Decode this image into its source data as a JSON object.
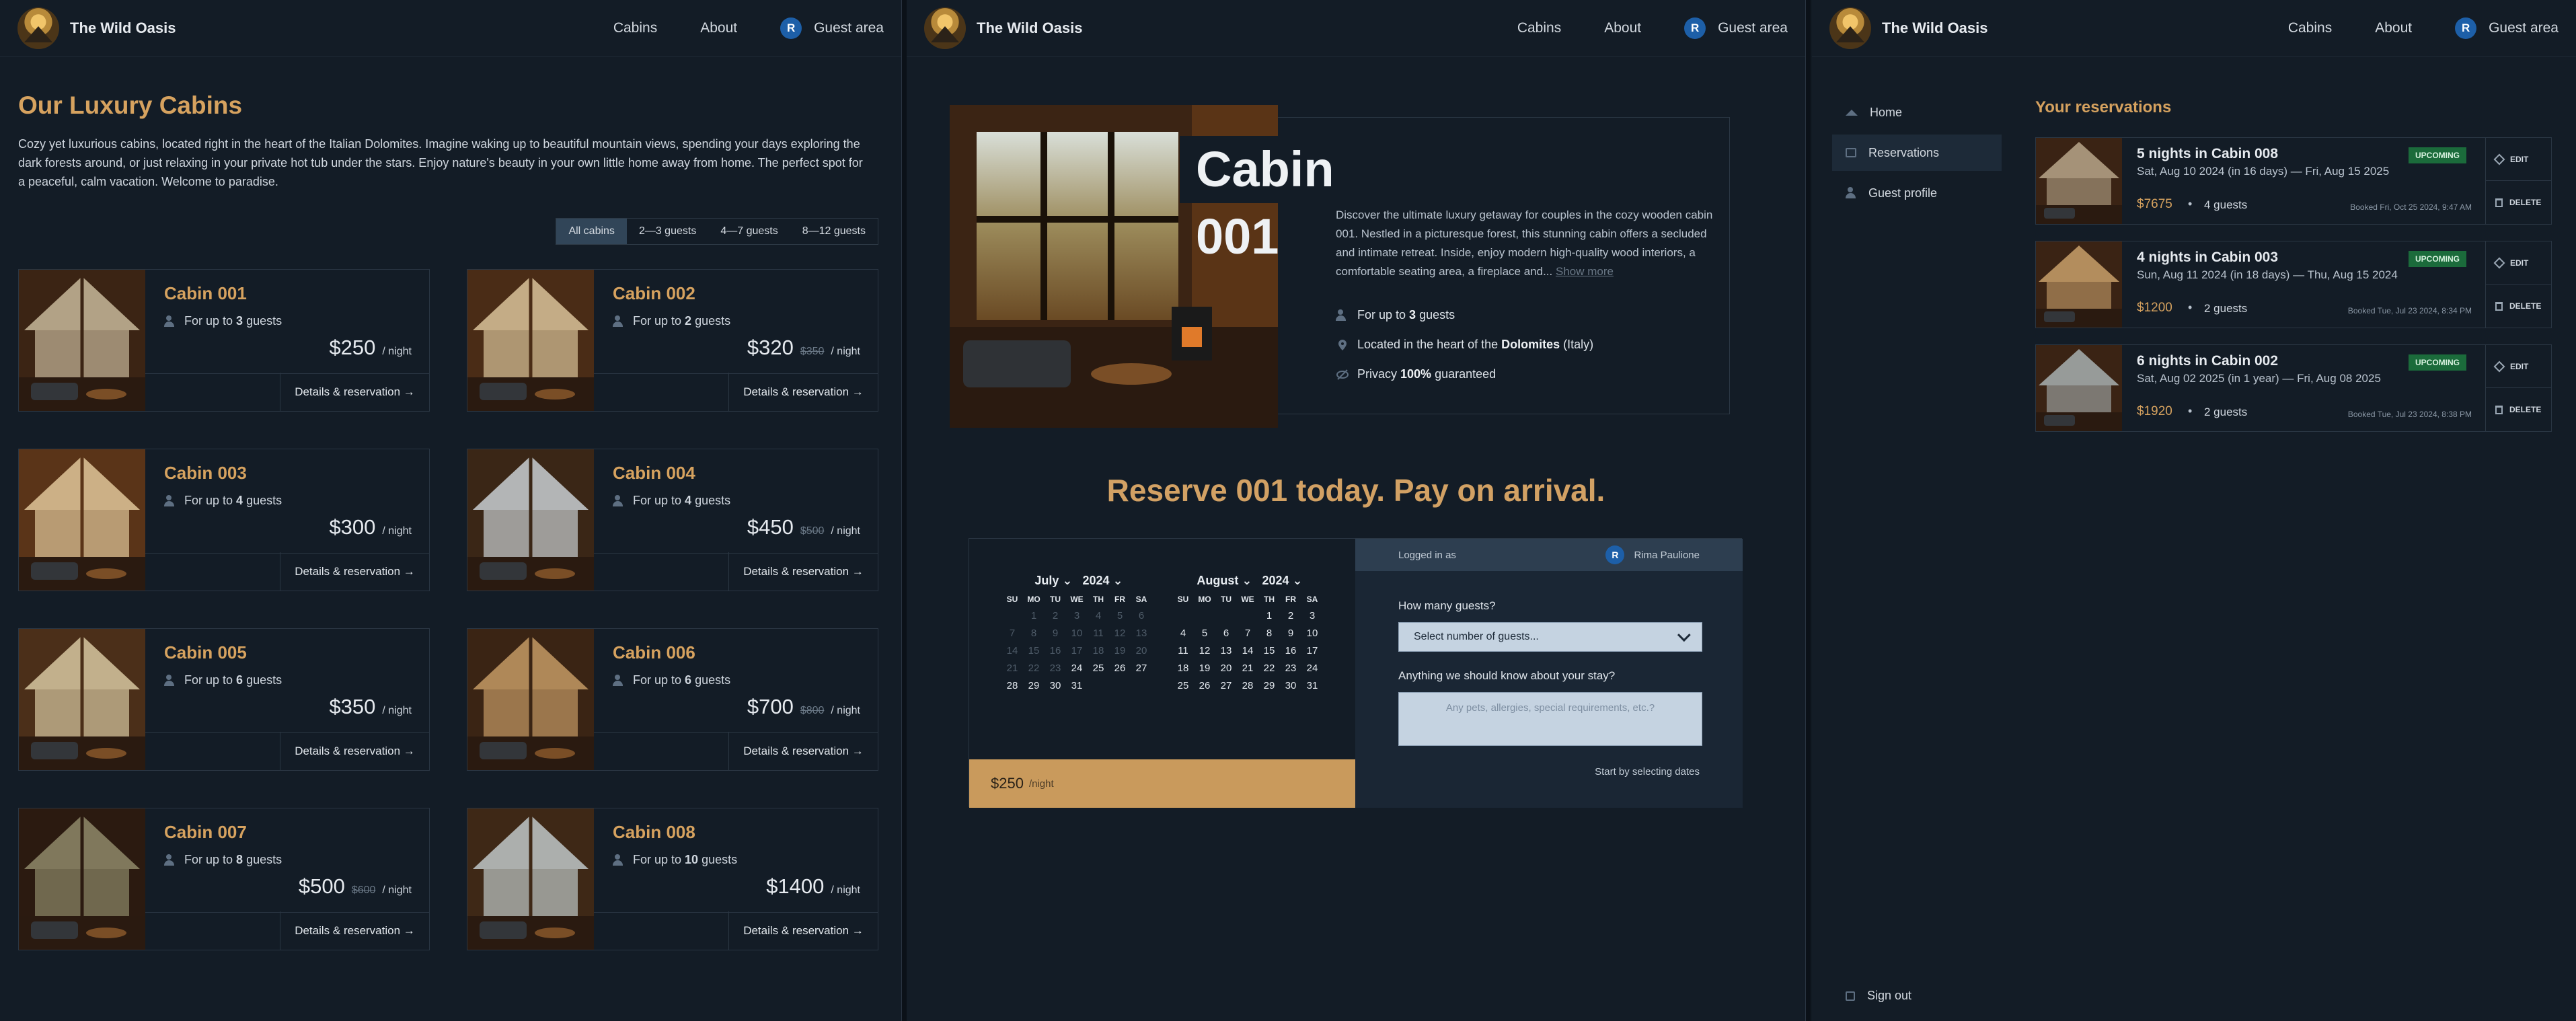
{
  "header": {
    "brand": "The Wild Oasis",
    "nav_cabins": "Cabins",
    "nav_about": "About",
    "nav_guest": "Guest area",
    "avatar_initial": "R"
  },
  "cabins_page": {
    "title": "Our Luxury Cabins",
    "description": "Cozy yet luxurious cabins, located right in the heart of the Italian Dolomites. Imagine waking up to beautiful mountain views, spending your days exploring the dark forests around, or just relaxing in your private hot tub under the stars. Enjoy nature's beauty in your own little home away from home. The perfect spot for a peaceful, calm vacation. Welcome to paradise.",
    "filters": [
      "All cabins",
      "2—3 guests",
      "4—7 guests",
      "8—12 guests"
    ],
    "details_label": "Details & reservation →",
    "per_night": "/ night",
    "cabins": [
      {
        "name": "Cabin 001",
        "guests_prefix": "For up to ",
        "guests": "3",
        "guests_suffix": " guests",
        "price": "$250",
        "old_price": ""
      },
      {
        "name": "Cabin 002",
        "guests_prefix": "For up to ",
        "guests": "2",
        "guests_suffix": " guests",
        "price": "$320",
        "old_price": "$350"
      },
      {
        "name": "Cabin 003",
        "guests_prefix": "For up to ",
        "guests": "4",
        "guests_suffix": " guests",
        "price": "$300",
        "old_price": ""
      },
      {
        "name": "Cabin 004",
        "guests_prefix": "For up to ",
        "guests": "4",
        "guests_suffix": " guests",
        "price": "$450",
        "old_price": "$500"
      },
      {
        "name": "Cabin 005",
        "guests_prefix": "For up to ",
        "guests": "6",
        "guests_suffix": " guests",
        "price": "$350",
        "old_price": ""
      },
      {
        "name": "Cabin 006",
        "guests_prefix": "For up to ",
        "guests": "6",
        "guests_suffix": " guests",
        "price": "$700",
        "old_price": "$800"
      },
      {
        "name": "Cabin 007",
        "guests_prefix": "For up to ",
        "guests": "8",
        "guests_suffix": " guests",
        "price": "$500",
        "old_price": "$600"
      },
      {
        "name": "Cabin 008",
        "guests_prefix": "For up to ",
        "guests": "10",
        "guests_suffix": " guests",
        "price": "$1400",
        "old_price": ""
      }
    ]
  },
  "cabin_page": {
    "title": "Cabin 001",
    "description": "Discover the ultimate luxury getaway for couples in the cozy wooden cabin 001. Nestled in a picturesque forest, this stunning cabin offers a secluded and intimate retreat. Inside, enjoy modern high-quality wood interiors, a comfortable seating area, a fireplace and...",
    "show_more": "Show more",
    "feat_guests_prefix": "For up to ",
    "feat_guests": "3",
    "feat_guests_suffix": " guests",
    "feat_loc_prefix": "Located in the heart of the ",
    "feat_loc": "Dolomites",
    "feat_loc_suffix": " (Italy)",
    "feat_priv_prefix": "Privacy ",
    "feat_priv": "100%",
    "feat_priv_suffix": " guaranteed",
    "reserve_title": "Reserve 001 today. Pay on arrival.",
    "calendar": {
      "weekdays": [
        "SU",
        "MO",
        "TU",
        "WE",
        "TH",
        "FR",
        "SA"
      ],
      "month1": "July",
      "year1": "2024",
      "month2": "August",
      "year2": "2024"
    },
    "price": "$250",
    "price_unit": "/night",
    "logged_in_as": "Logged in as",
    "user_name": "Rima Paulione",
    "guests_label": "How many guests?",
    "guests_placeholder": "Select number of guests...",
    "observations_label": "Anything we should know about your stay?",
    "observations_placeholder": "Any pets, allergies, special requirements, etc.?",
    "start_text": "Start by selecting dates"
  },
  "account_page": {
    "nav_home": "Home",
    "nav_reservations": "Reservations",
    "nav_profile": "Guest profile",
    "sign_out": "Sign out",
    "title": "Your reservations",
    "edit_label": "EDIT",
    "delete_label": "DELETE",
    "reservations": [
      {
        "title": "5 nights in Cabin 008",
        "dates": "Sat, Aug 10 2024 (in 16 days) — Fri, Aug 15 2025",
        "status": "UPCOMING",
        "price": "$7675",
        "guests": "4 guests",
        "booked": "Booked Fri, Oct 25 2024, 9:47 AM"
      },
      {
        "title": "4 nights in Cabin 003",
        "dates": "Sun, Aug 11 2024 (in 18 days) — Thu, Aug 15 2024",
        "status": "UPCOMING",
        "price": "$1200",
        "guests": "2 guests",
        "booked": "Booked Tue, Jul 23 2024, 8:34 PM"
      },
      {
        "title": "6 nights in Cabin 002",
        "dates": "Sat, Aug 02 2025 (in 1 year) — Fri, Aug 08 2025",
        "status": "UPCOMING",
        "price": "$1920",
        "guests": "2 guests",
        "booked": "Booked Tue, Jul 23 2024, 8:38 PM"
      }
    ]
  },
  "colors": {
    "accent": "#d6a25f",
    "background": "#131c26",
    "upcoming": "#1b6b3b",
    "price_strip": "#c99a5c"
  }
}
